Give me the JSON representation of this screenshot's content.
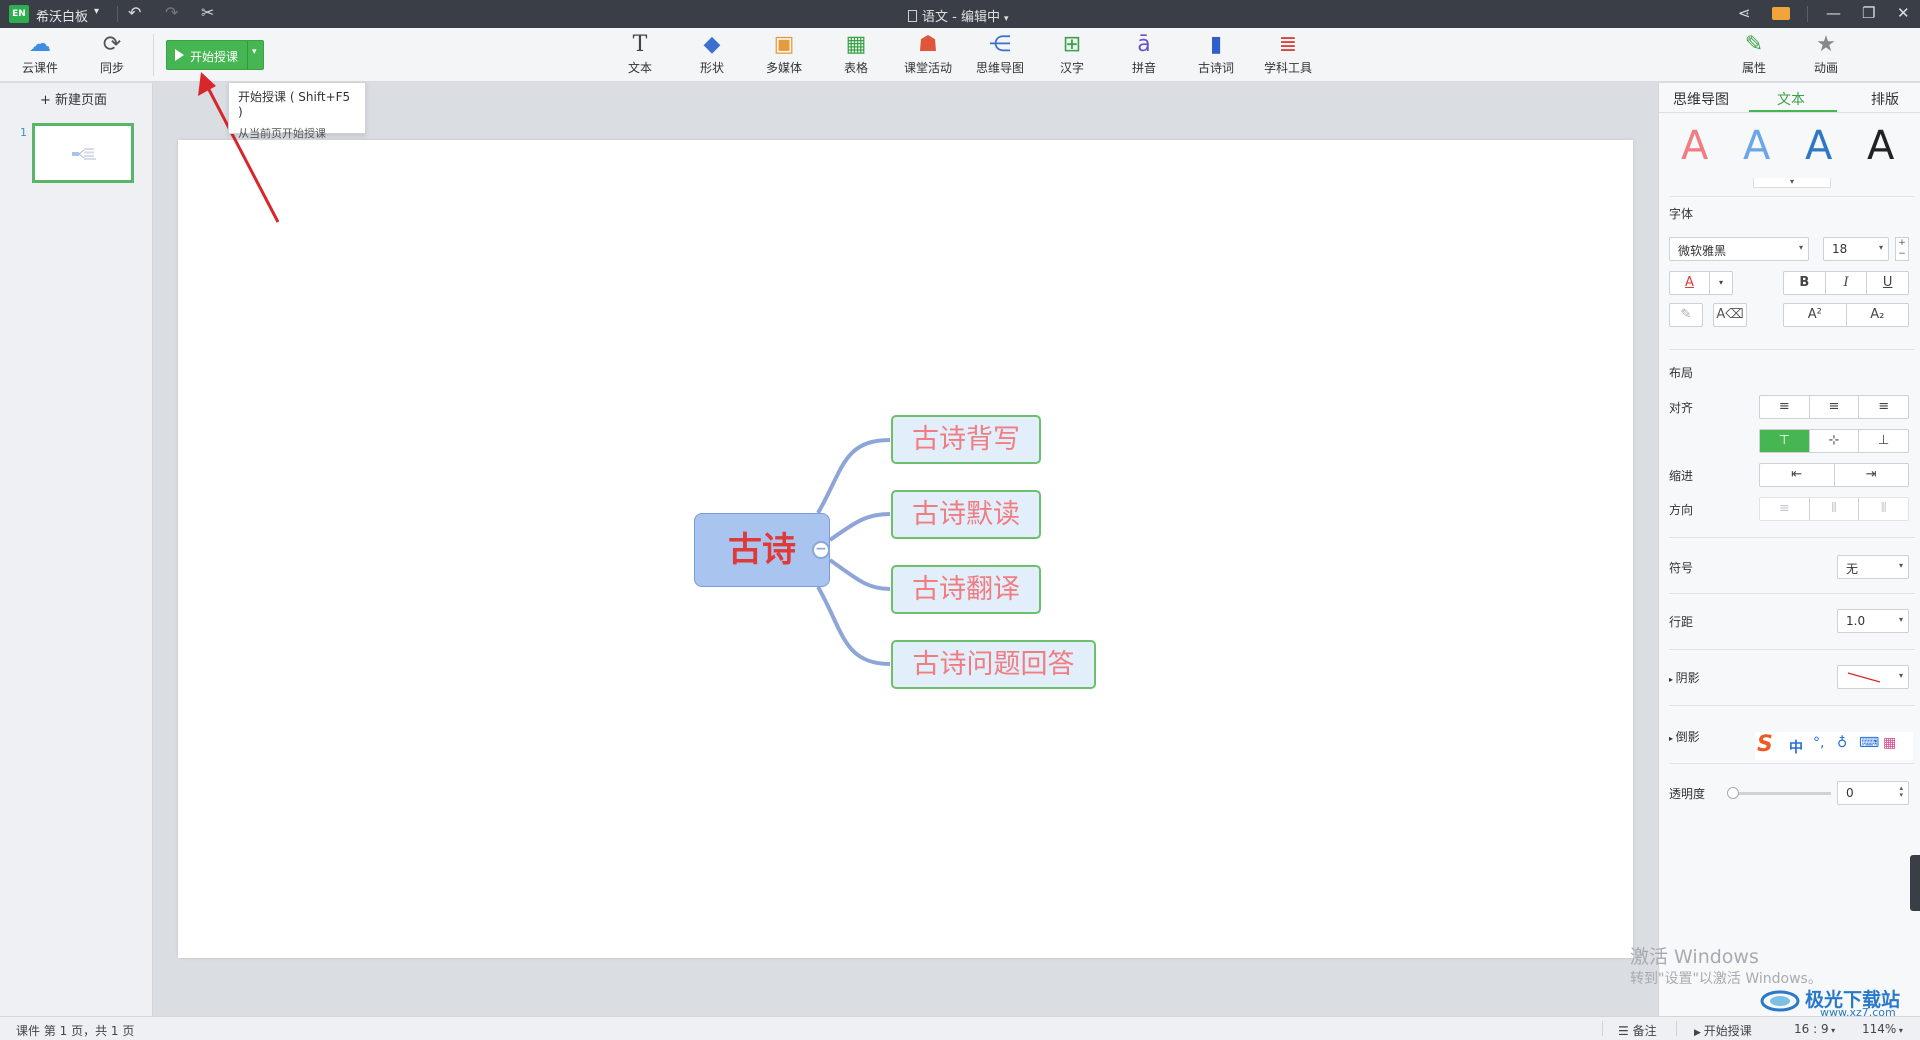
{
  "titlebar": {
    "logo_text": "EN",
    "app_name": "希沃白板",
    "document_title": "语文 - 编辑中"
  },
  "ribbon": {
    "cloud_label": "云课件",
    "sync_label": "同步",
    "start_label": "开始授课",
    "tools": [
      {
        "label": "文本",
        "icon": "text-icon"
      },
      {
        "label": "形状",
        "icon": "shape-icon"
      },
      {
        "label": "多媒体",
        "icon": "media-icon"
      },
      {
        "label": "表格",
        "icon": "table-icon"
      },
      {
        "label": "课堂活动",
        "icon": "classroom-activity-icon"
      },
      {
        "label": "思维导图",
        "icon": "mindmap-icon"
      },
      {
        "label": "汉字",
        "icon": "hanzi-icon"
      },
      {
        "label": "拼音",
        "icon": "pinyin-icon"
      },
      {
        "label": "古诗词",
        "icon": "poetry-icon"
      },
      {
        "label": "学科工具",
        "icon": "subject-tools-icon"
      }
    ],
    "properties_label": "属性",
    "animation_label": "动画"
  },
  "tooltip": {
    "title": "开始授课 ( Shift+F5 )",
    "desc": "从当前页开始授课"
  },
  "leftpanel": {
    "new_page_label": "新建页面",
    "thumb_number": "1"
  },
  "mindmap": {
    "central": "古诗",
    "branches": [
      "古诗背写",
      "古诗默读",
      "古诗翻译",
      "古诗问题回答"
    ],
    "colors": {
      "central_text": "#e0393a",
      "central_fill": "#a8c4ef",
      "branch_border": "#6cbf6c",
      "branch_text": "#f07d82",
      "line": "#8ea5d8"
    }
  },
  "rightpanel": {
    "tabs": [
      "思维导图",
      "文本",
      "排版"
    ],
    "active_tab": "文本",
    "font_section": "字体",
    "font_name": "微软雅黑",
    "font_size": "18",
    "format_buttons": [
      "B",
      "I",
      "U"
    ],
    "super_label": "A²",
    "sub_label": "A₂",
    "layout_section": "布局",
    "align_label": "对齐",
    "indent_label": "缩进",
    "direction_label": "方向",
    "bullet_label": "符号",
    "bullet_value": "无",
    "line_spacing_label": "行距",
    "line_spacing_value": "1.0",
    "shadow_label": "阴影",
    "reflection_label": "倒影",
    "opacity_label": "透明度",
    "opacity_value": "0"
  },
  "ime": {
    "mode": "中"
  },
  "statusbar": {
    "page_info": "课件 第 1 页，共 1 页",
    "notes": "备注",
    "start": "开始授课",
    "ratio": "16 : 9",
    "zoom": "114%"
  },
  "watermark": {
    "line1": "激活 Windows",
    "line2": "转到\"设置\"以激活 Windows。"
  },
  "brand": {
    "name": "极光下载站",
    "url": "www.xz7.com"
  }
}
